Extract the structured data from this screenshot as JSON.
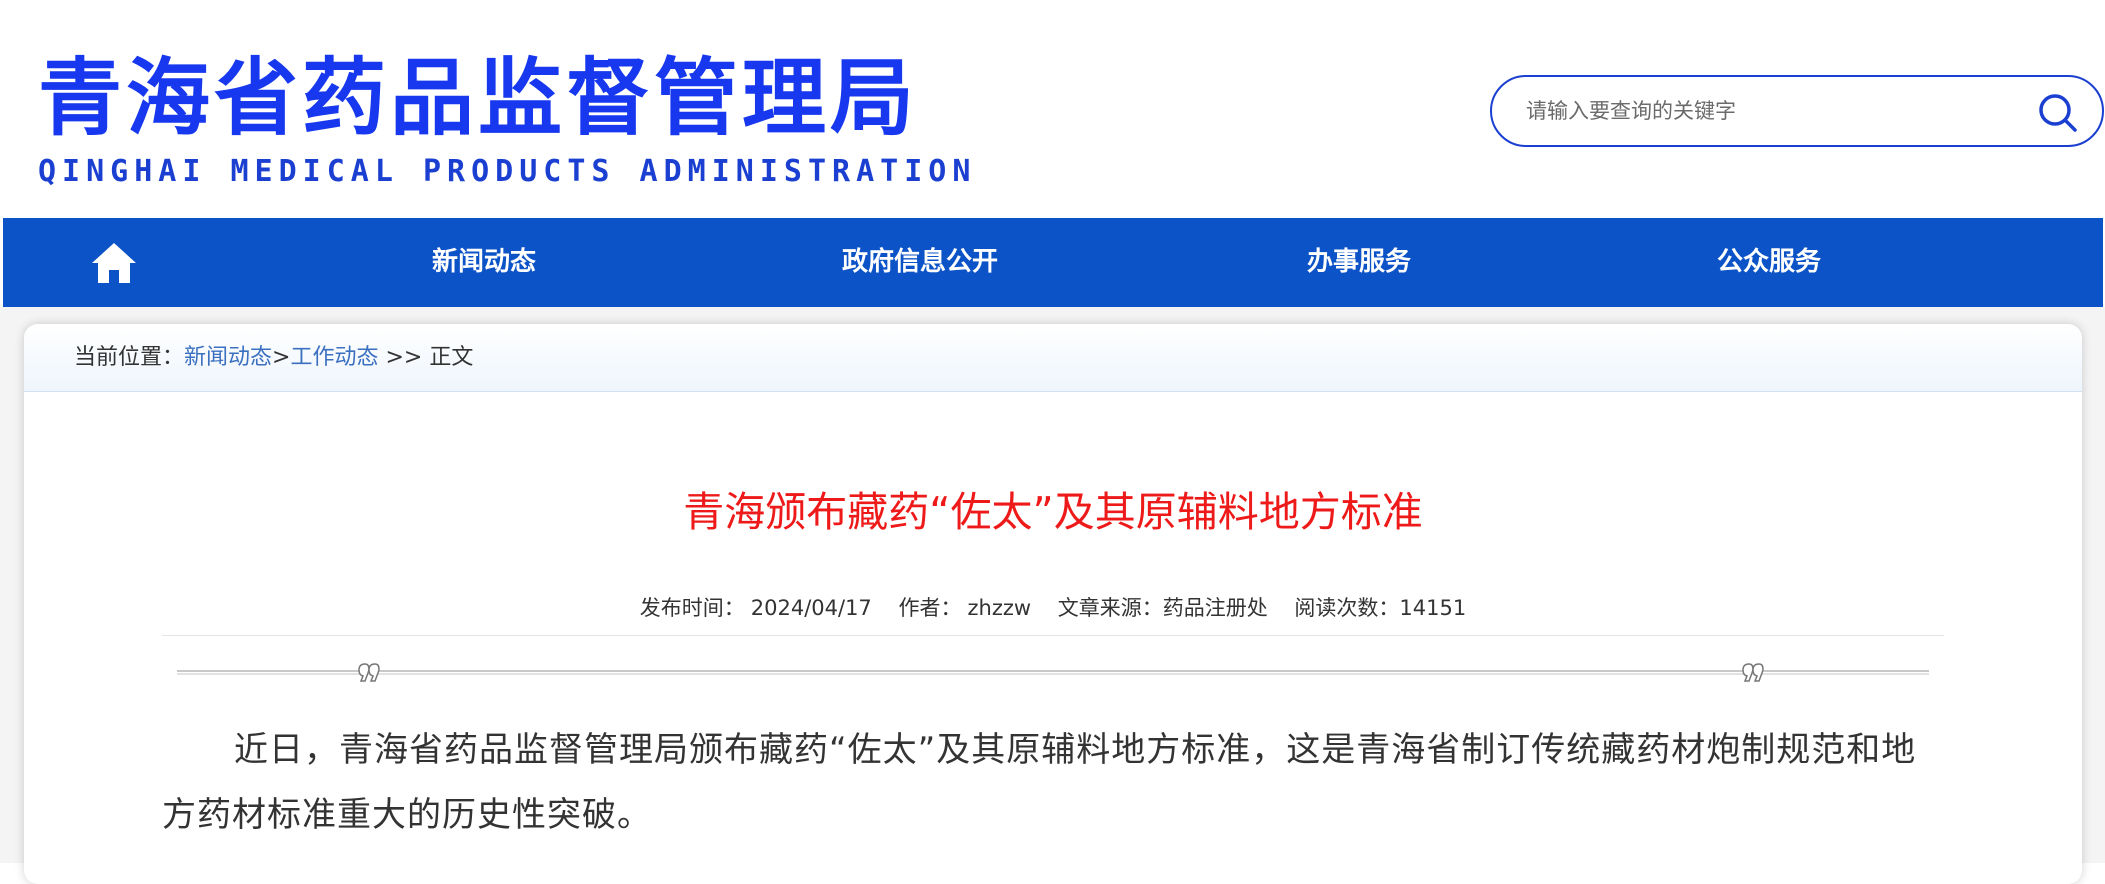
{
  "header": {
    "logo_cn": "青海省药品监督管理局",
    "logo_en": "QINGHAI MEDICAL PRODUCTS ADMINISTRATION",
    "search": {
      "placeholder": "请输入要查询的关键字",
      "value": "",
      "icon": "search-icon"
    }
  },
  "nav": {
    "home_icon": "home-icon",
    "items": [
      {
        "label": "新闻动态"
      },
      {
        "label": "政府信息公开"
      },
      {
        "label": "办事服务"
      },
      {
        "label": "公众服务"
      }
    ]
  },
  "breadcrumb": {
    "prefix": "当前位置：",
    "level1": "新闻动态",
    "sep1": ">",
    "level2": "工作动态",
    "sep2": " >> ",
    "current": "正文"
  },
  "article": {
    "title": "青海颁布藏药“佐太”及其原辅料地方标准",
    "meta": {
      "date_label": "发布时间：",
      "date": "2024/04/17",
      "author_label": "作者：",
      "author": "zhzzw",
      "source_label": "文章来源：",
      "source": "药品注册处",
      "views_label": "阅读次数：",
      "views": "14151"
    },
    "body": "近日，青海省药品监督管理局颁布藏药“佐太”及其原辅料地方标准，这是青海省制订传统藏药材炮制规范和地方药材标准重大的历史性突破。"
  },
  "colors": {
    "logo_blue": "#1738ef",
    "nav_blue": "#0c53c7",
    "title_red": "#ee1a1a",
    "link_blue": "#3b70c0"
  }
}
